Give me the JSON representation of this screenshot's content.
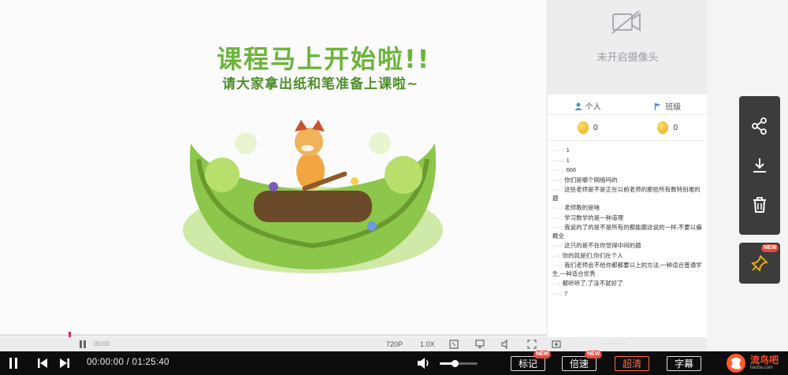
{
  "top_caption": "",
  "slide": {
    "title": "课程马上开始啦!!",
    "subtitle": "请大家拿出纸和笔准备上课啦~"
  },
  "camera": {
    "status": "未开启摄像头"
  },
  "tabs": [
    {
      "label": "个人"
    },
    {
      "label": "班级"
    }
  ],
  "coins": [
    {
      "value": "0"
    },
    {
      "value": "0"
    }
  ],
  "chat": [
    {
      "text": "1"
    },
    {
      "text": "1"
    },
    {
      "text": "666"
    },
    {
      "text": "你们是哪个网络吗的"
    },
    {
      "text": "这些老师是不是正在以前老师的那些所有数特别难的题"
    },
    {
      "text": "老师教的是啥"
    },
    {
      "text": "学习数学的是一种道理"
    },
    {
      "text": "我说的了的是不是所有的都能跟这说的一样,不要以偏概全"
    },
    {
      "text": "这只的是不在你觉得中间的题"
    },
    {
      "text": "你的就是们,你们在个人"
    },
    {
      "text": "我们老师会不给你都都要以上的方法,一种适合普通学生,一种适合优秀"
    },
    {
      "text": "都听听了,了没不就好了"
    },
    {
      "text": "7"
    }
  ],
  "inner_bar": {
    "time": "00:00",
    "quality": "720P",
    "speed": "1.0X"
  },
  "player": {
    "time_current": "00:00:00",
    "time_separator": "/",
    "time_total": "01:25:40",
    "volume": 0.4,
    "buttons": [
      {
        "label": "标记",
        "badge": "NEW"
      },
      {
        "label": "倍速",
        "badge": "NEW"
      },
      {
        "label": "超清"
      },
      {
        "label": "字幕"
      }
    ]
  },
  "logo": {
    "name": "流鸟吧",
    "url_text": "liaoba.com"
  },
  "icons": {
    "camera_off": "camera-off-icon",
    "user": "user-icon",
    "flag": "flag-icon",
    "share": "share-icon",
    "download": "download-icon",
    "delete": "trash-icon",
    "pin": "pin-icon",
    "play_pause": "pause-icon",
    "prev": "prev-icon",
    "next": "next-icon",
    "volume": "volume-icon"
  },
  "colors": {
    "accent": "#ff6a3c",
    "slide_green": "#6cb43a",
    "progress_mark": "#e0295b"
  }
}
